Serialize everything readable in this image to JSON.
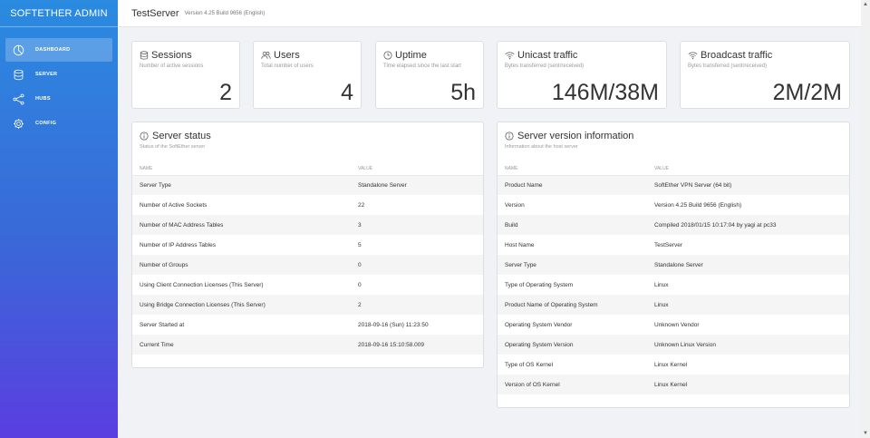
{
  "brand": "SOFTETHER ADMIN",
  "nav": [
    {
      "label": "DASHBOARD",
      "icon": "dashboard-icon",
      "active": true
    },
    {
      "label": "SERVER",
      "icon": "database-icon",
      "active": false
    },
    {
      "label": "HUBS",
      "icon": "share-icon",
      "active": false
    },
    {
      "label": "CONFIG",
      "icon": "gear-icon",
      "active": false
    }
  ],
  "header": {
    "title": "TestServer",
    "version": "Version 4.25 Build 9656 (English)"
  },
  "stats": {
    "sessions": {
      "title": "Sessions",
      "subtitle": "Number of active sessions",
      "value": "2"
    },
    "users": {
      "title": "Users",
      "subtitle": "Total number of users",
      "value": "4"
    },
    "uptime": {
      "title": "Uptime",
      "subtitle": "Time elapsed since the last start",
      "value": "5h"
    },
    "unicast": {
      "title": "Unicast traffic",
      "subtitle": "Bytes transferred (sent/received)",
      "value": "146M/38M"
    },
    "broadcast": {
      "title": "Broadcast traffic",
      "subtitle": "Bytes transferred (sent/received)",
      "value": "2M/2M"
    }
  },
  "server_status": {
    "title": "Server status",
    "subtitle": "Status of the SoftEther server",
    "col_name": "NAME",
    "col_value": "VALUE",
    "rows": [
      [
        "Server Type",
        "Standalone Server"
      ],
      [
        "Number of Active Sockets",
        "22"
      ],
      [
        "Number of MAC Address Tables",
        "3"
      ],
      [
        "Number of IP Address Tables",
        "5"
      ],
      [
        "Number of Groups",
        "0"
      ],
      [
        "Using Client Connection Licenses (This Server)",
        "0"
      ],
      [
        "Using Bridge Connection Licenses (This Server)",
        "2"
      ],
      [
        "Server Started at",
        "2018-09-16 (Sun) 11:23:50"
      ],
      [
        "Current Time",
        "2018-09-16 15:10:58.009"
      ]
    ]
  },
  "version_info": {
    "title": "Server version information",
    "subtitle": "Information about the host server",
    "col_name": "NAME",
    "col_value": "VALUE",
    "rows": [
      [
        "Product Name",
        "SoftEther VPN Server (64 bit)"
      ],
      [
        "Version",
        "Version 4.25 Build 9656 (English)"
      ],
      [
        "Build",
        "Compiled 2018/01/15 10:17:04 by yagi at pc33"
      ],
      [
        "Host Name",
        "TestServer"
      ],
      [
        "Server Type",
        "Standalone Server"
      ],
      [
        "Type of Operating System",
        "Linux"
      ],
      [
        "Product Name of Operating System",
        "Linux"
      ],
      [
        "Operating System Vendor",
        "Unknown Vendor"
      ],
      [
        "Operating System Version",
        "Unknown Linux Version"
      ],
      [
        "Type of OS Kernel",
        "Linux Kernel"
      ],
      [
        "Version of OS Kernel",
        "Linux Kernel"
      ]
    ]
  }
}
